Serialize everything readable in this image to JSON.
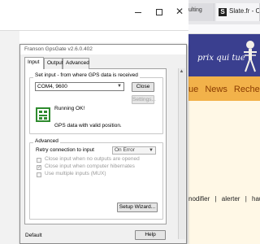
{
  "browser": {
    "tabs": [
      {
        "label": "ulting"
      },
      {
        "label": "Slate.fr - Cultu",
        "favicon": "S"
      }
    ],
    "banner_text": "prix qui tue",
    "nav_items": [
      "ue",
      "News",
      "Recherc"
    ],
    "links": [
      "nodifier",
      "|",
      "alerter",
      "|",
      "haut"
    ]
  },
  "dialog": {
    "title": "Franson GpsGate v2.6.0.402",
    "tabs": [
      "Input",
      "Output",
      "Advanced"
    ],
    "input_group": {
      "label": "Set input - from where GPS data is received",
      "source_value": "COM4, 9600",
      "close_label": "Close",
      "settings_label": "Settings...",
      "status_running": "Running OK!",
      "status_valid": "GPS data with valid position."
    },
    "advanced_group": {
      "label": "Advanced",
      "retry_label": "Retry connection to input",
      "retry_value": "On Error",
      "checkboxes": [
        {
          "label": "Close input when no outputs are opened",
          "checked": false
        },
        {
          "label": "Close input when computer hibernates",
          "checked": true
        },
        {
          "label": "Use multiple inputs (MUX)",
          "checked": false
        }
      ]
    },
    "setup_label": "Setup Wizard...",
    "default_label": "Default",
    "help_label": "Help"
  },
  "colors": {
    "banner": "#3a3f8f",
    "nav": "#f2b24a",
    "status_icon": "#2e8b2e"
  }
}
